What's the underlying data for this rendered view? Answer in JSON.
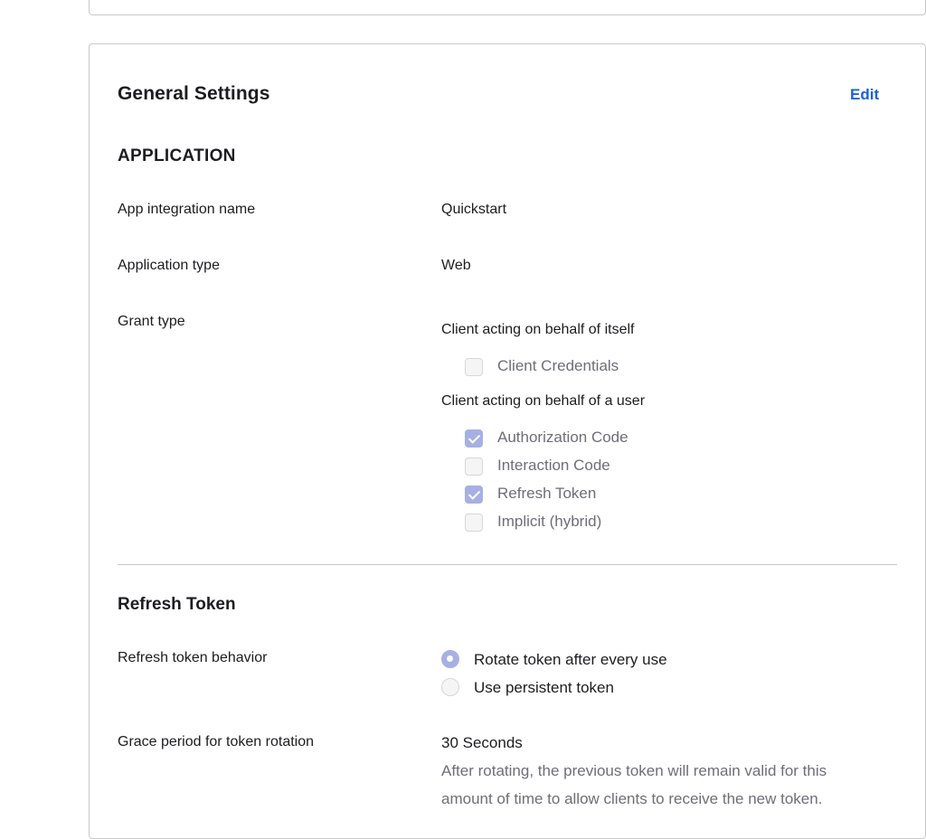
{
  "general": {
    "title": "General Settings",
    "edit_label": "Edit"
  },
  "application": {
    "heading": "APPLICATION",
    "rows": {
      "name_label": "App integration name",
      "name_value": "Quickstart",
      "type_label": "Application type",
      "type_value": "Web",
      "grant_label": "Grant type"
    },
    "grant": {
      "group_self": "Client acting on behalf of itself",
      "group_user": "Client acting on behalf of a user",
      "options": [
        {
          "label": "Client Credentials",
          "checked": false
        },
        {
          "label": "Authorization Code",
          "checked": true
        },
        {
          "label": "Interaction Code",
          "checked": false
        },
        {
          "label": "Refresh Token",
          "checked": true
        },
        {
          "label": "Implicit (hybrid)",
          "checked": false
        }
      ]
    }
  },
  "refresh": {
    "heading": "Refresh Token",
    "behavior_label": "Refresh token behavior",
    "behavior_options": [
      {
        "label": "Rotate token after every use",
        "selected": true
      },
      {
        "label": "Use persistent token",
        "selected": false
      }
    ],
    "grace_label": "Grace period for token rotation",
    "grace_value": "30 Seconds",
    "grace_desc": "After rotating, the previous token will remain valid for this amount of time to allow clients to receive the new token."
  },
  "colors": {
    "accent_link": "#1662dd",
    "checked_fill": "#a6b0e4",
    "border": "#c9c9cc"
  }
}
